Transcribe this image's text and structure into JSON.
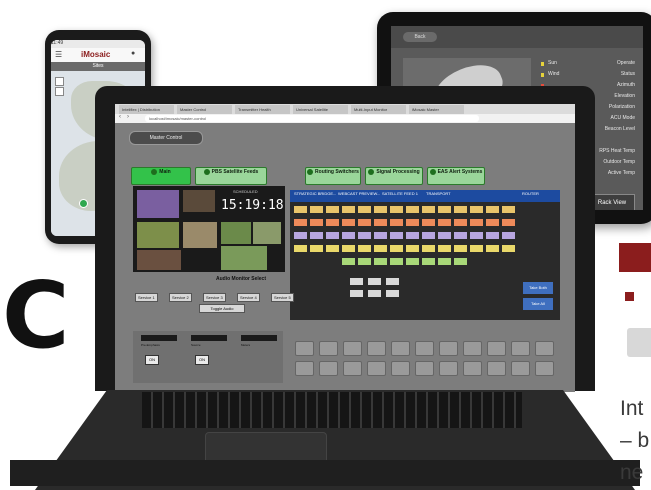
{
  "side_text": {
    "big_letter": "C",
    "line1": "Int",
    "line2": "– b",
    "line3": "ne"
  },
  "colors": {
    "brand_red": "#8b1d1d",
    "switch_green": "#33c24a",
    "switch_green_light": "#9ad69a",
    "grid_blue": "#1d4ba0",
    "take_blue": "#3f6fbf"
  },
  "phone": {
    "logo": "iMosaic",
    "status_time": "11:49",
    "subbar": "Sites"
  },
  "tablet": {
    "header_button": "Back",
    "status_list": [
      {
        "label": "Sun",
        "value": "Operate",
        "color": "#e6d23b"
      },
      {
        "label": "Wind",
        "value": "Status",
        "color": "#e6d23b"
      },
      {
        "label": "",
        "value": "Azimuth",
        "color": "#e64a3b"
      },
      {
        "label": "",
        "value": "Elevation",
        "color": ""
      },
      {
        "label": "",
        "value": "Polarization",
        "color": ""
      },
      {
        "label": "",
        "value": "ACU Mode",
        "color": ""
      },
      {
        "label": "",
        "value": "Beacon Level",
        "color": ""
      },
      {
        "label": "",
        "value": "",
        "color": ""
      },
      {
        "label": "",
        "value": "RPS Heat Temp",
        "color": ""
      },
      {
        "label": "",
        "value": "Outdoor Temp",
        "color": ""
      },
      {
        "label": "",
        "value": "Active Temp",
        "color": ""
      }
    ],
    "rack_button": "Rack View"
  },
  "laptop": {
    "browser_tabs": [
      "Inteliflex | Distribution",
      "Master Control",
      "Transmitter Health",
      "Universal Satellite",
      "Multi-Input Monitor",
      "iMosaic Master"
    ],
    "url": "localhost/imosaic/master-control",
    "master_button": "Master Control",
    "switches": [
      {
        "label": "Main",
        "active": true
      },
      {
        "label": "PBS Satellite Feeds",
        "active": false
      },
      {
        "label": "Routing Switchers",
        "active": false
      },
      {
        "label": "Signal Processing",
        "active": false
      },
      {
        "label": "EAS Alert Systems",
        "active": false
      }
    ],
    "preview_clock": "15:19:18",
    "preview_clock_label": "SCHEDULED",
    "audio_monitor_title": "Audio Monitor Select",
    "audio_options": [
      "Service 1",
      "Service 2",
      "Service 3",
      "Service 4",
      "Service 5"
    ],
    "toggle_label": "Toggle Audio",
    "grid_header": [
      "STRATEGIC BRIDGE...",
      "WEBCAST PREVIEW...",
      "SATELLITE FEED 1",
      "TRANSPORT"
    ],
    "grid_right_label": "ROUTER",
    "take_label": "Take Both",
    "take_all_label": "Take All",
    "bottom_monitors": [
      {
        "label": "",
        "caption": "Pre-Emphasis",
        "state": "ON"
      },
      {
        "label": "",
        "caption": "Source",
        "state": "ON"
      },
      {
        "label": "",
        "caption": "Meters",
        "state": ""
      }
    ]
  }
}
